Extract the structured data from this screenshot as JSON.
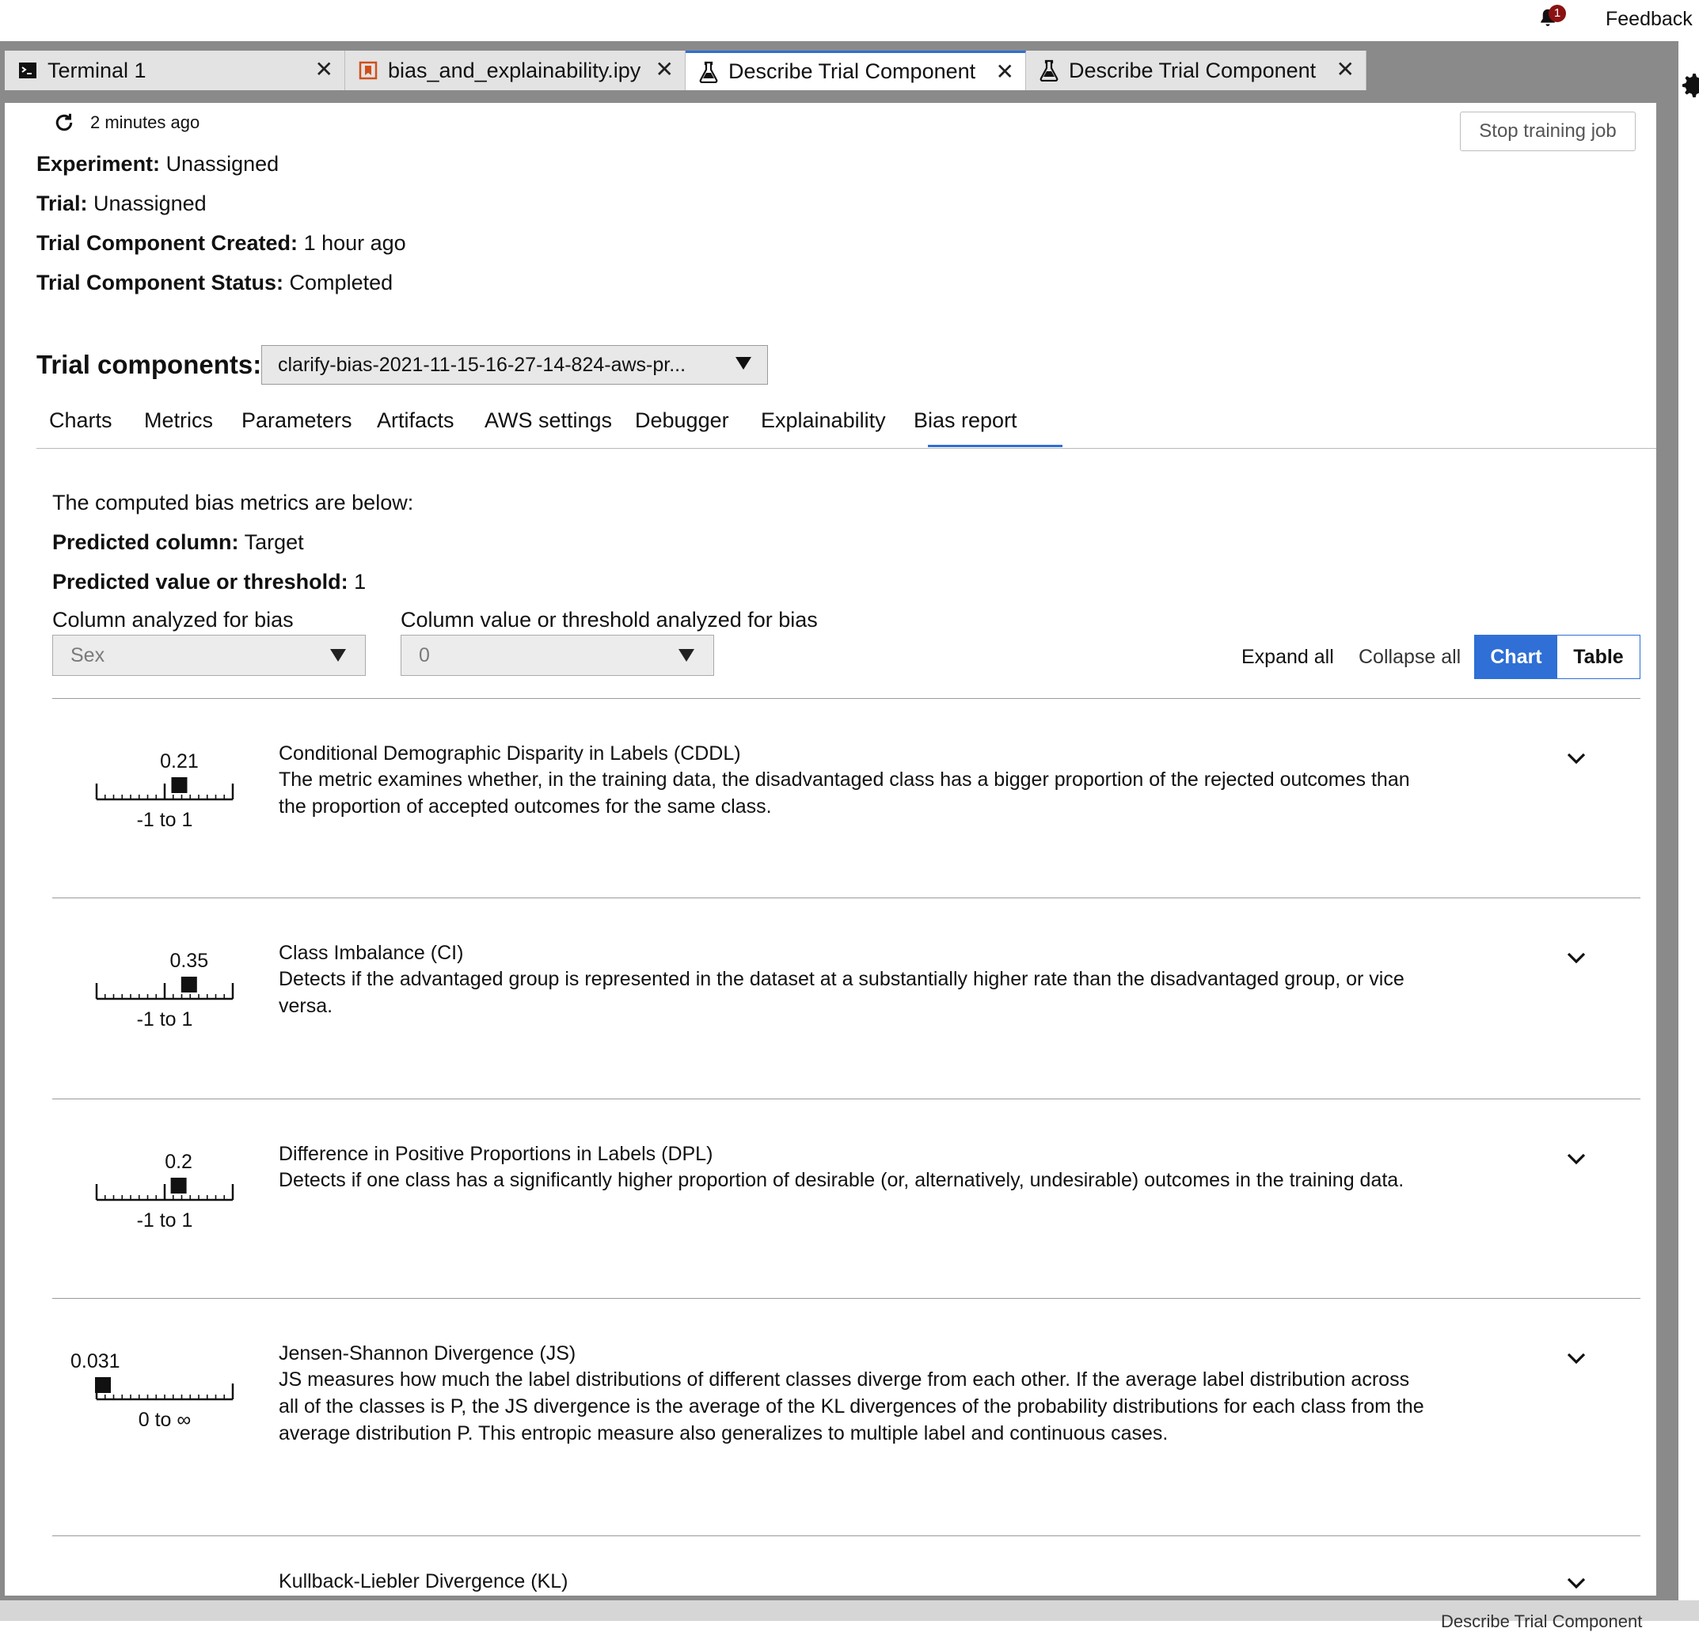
{
  "topbar": {
    "notification_count": "1",
    "feedback_label": "Feedback"
  },
  "tabs": [
    {
      "label": "Terminal 1",
      "icon": "terminal-icon"
    },
    {
      "label": "bias_and_explainability.ipynb",
      "icon": "notebook-icon"
    },
    {
      "label": "Describe Trial Component",
      "icon": "flask-icon"
    },
    {
      "label": "Describe Trial Component",
      "icon": "flask-icon"
    }
  ],
  "header": {
    "refreshed": "2 minutes ago",
    "stop_button": "Stop training job",
    "experiment_label": "Experiment:",
    "experiment_value": "Unassigned",
    "trial_label": "Trial:",
    "trial_value": "Unassigned",
    "created_label": "Trial Component Created:",
    "created_value": "1 hour ago",
    "status_label": "Trial Component Status:",
    "status_value": "Completed"
  },
  "trial_components": {
    "label": "Trial components:",
    "selected": "clarify-bias-2021-11-15-16-27-14-824-aws-pr..."
  },
  "nav": {
    "items": [
      "Charts",
      "Metrics",
      "Parameters",
      "Artifacts",
      "AWS settings",
      "Debugger",
      "Explainability",
      "Bias report"
    ],
    "active": "Bias report"
  },
  "bias": {
    "intro": "The computed bias metrics are below:",
    "predicted_column_label": "Predicted column:",
    "predicted_column_value": "Target",
    "predicted_value_label": "Predicted value or threshold:",
    "predicted_value_value": "1",
    "column_label": "Column analyzed for bias",
    "column_value": "Sex",
    "threshold_label": "Column value or threshold analyzed for bias",
    "threshold_value": "0",
    "expand_all": "Expand all",
    "collapse_all": "Collapse all",
    "view_chart": "Chart",
    "view_table": "Table",
    "view_selected": "Chart"
  },
  "metrics": [
    {
      "value_label": "0.21",
      "value": 0.21,
      "range_label": "-1 to 1",
      "range": [
        -1,
        1
      ],
      "title": "Conditional Demographic Disparity in Labels (CDDL)",
      "description": "The metric examines whether, in the training data, the disadvantaged class has a bigger proportion of the rejected outcomes than the proportion of accepted outcomes for the same class."
    },
    {
      "value_label": "0.35",
      "value": 0.35,
      "range_label": "-1 to 1",
      "range": [
        -1,
        1
      ],
      "title": "Class Imbalance (CI)",
      "description": "Detects if the advantaged group is represented in the dataset at a substantially higher rate than the disadvantaged group, or vice versa."
    },
    {
      "value_label": "0.2",
      "value": 0.2,
      "range_label": "-1 to 1",
      "range": [
        -1,
        1
      ],
      "title": "Difference in Positive Proportions in Labels (DPL)",
      "description": "Detects if one class has a significantly higher proportion of desirable (or, alternatively, undesirable) outcomes in the training data."
    },
    {
      "value_label": "0.031",
      "value": 0.031,
      "range_label": "0 to ∞",
      "range": [
        0,
        null
      ],
      "title": "Jensen-Shannon Divergence (JS)",
      "description": "JS measures how much the label distributions of different classes diverge from each other. If the average label distribution across all of the classes is P, the JS divergence is the average of the KL divergences of the probability distributions for each class from the average distribution P. This entropic measure also generalizes to multiple label and continuous cases."
    },
    {
      "value_label": "",
      "value": null,
      "range_label": "",
      "range": [
        0,
        null
      ],
      "title": "Kullback-Liebler Divergence (KL)",
      "description": ""
    }
  ],
  "bottom": {
    "ghost_tab": "Describe Trial Component"
  }
}
